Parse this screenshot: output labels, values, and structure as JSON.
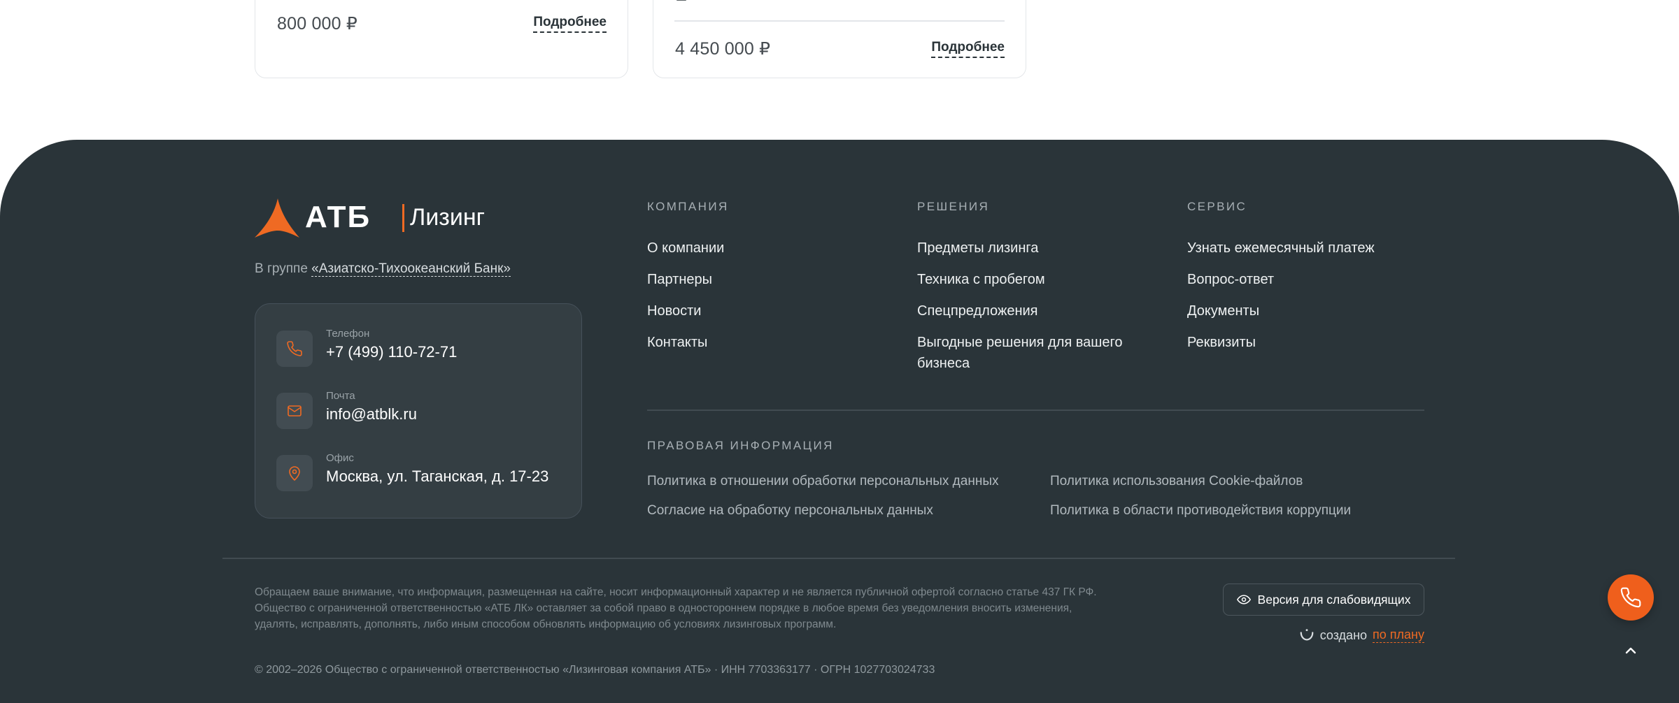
{
  "cards": [
    {
      "price": "800 000 ₽",
      "more_label": "Подробнее"
    },
    {
      "price": "4 450 000 ₽",
      "more_label": "Подробнее"
    }
  ],
  "footer": {
    "logo": {
      "brand": "АТБ",
      "product": "Лизинг"
    },
    "group": {
      "prefix": "В группе ",
      "link": "«Азиатско-Тихоокеанский Банк»"
    },
    "contacts": [
      {
        "label": "Телефон",
        "value": "+7 (499) 110-72-71",
        "icon": "phone-icon"
      },
      {
        "label": "Почта",
        "value": "info@atblk.ru",
        "icon": "mail-icon"
      },
      {
        "label": "Офис",
        "value": "Москва, ул. Таганская, д. 17-23",
        "icon": "location-icon"
      }
    ],
    "columns": [
      {
        "title": "КОМПАНИЯ",
        "links": [
          "О компании",
          "Партнеры",
          "Новости",
          "Контакты"
        ]
      },
      {
        "title": "РЕШЕНИЯ",
        "links": [
          "Предметы лизинга",
          "Техника с пробегом",
          "Спецпредложения",
          "Выгодные решения для вашего бизнеса"
        ]
      },
      {
        "title": "СЕРВИС",
        "links": [
          "Узнать ежемесячный платеж",
          "Вопрос-ответ",
          "Документы",
          "Реквизиты"
        ]
      }
    ],
    "legal": {
      "title": "ПРАВОВАЯ ИНФОРМАЦИЯ",
      "links": [
        "Политика в отношении обработки персональных данных",
        "Политика использования Cookie-файлов",
        "Согласие на обработку персональных данных",
        "Политика в области противодействия коррупции"
      ]
    },
    "disclaimer": [
      "Обращаем ваше внимание, что информация, размещенная на сайте, носит информационный характер и не является публичной офертой согласно статье 437 ГК РФ.",
      "Общество с ограниченной ответственностью «АТБ ЛК» оставляет за собой право в одностороннем порядке в любое время без уведомления вносить изменения,",
      "удалять, исправлять, дополнять, либо иным способом обновлять информацию об условиях лизинговых программ."
    ],
    "copyright": "© 2002–2026 Общество с ограниченной ответственностью «Лизинговая компания АТБ» · ИНН 7703363177 · ОГРН 1027703024733",
    "vision_button": "Версия для слабовидящих",
    "made_by": {
      "prefix": "создано",
      "link": "по плану"
    }
  },
  "colors": {
    "accent": "#ef6a23",
    "footer_bg": "#2a3439"
  }
}
